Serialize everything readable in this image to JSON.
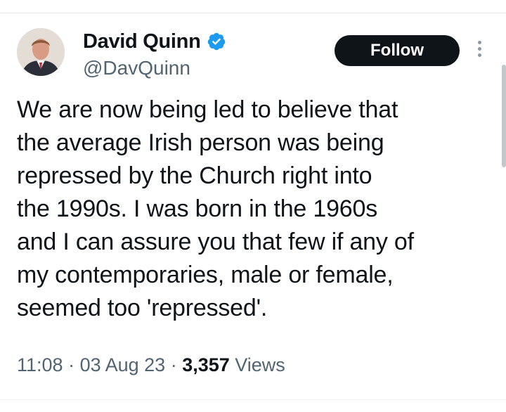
{
  "author": {
    "name": "David Quinn",
    "handle": "@DavQuinn",
    "verified_color": "#1d9bf0"
  },
  "actions": {
    "follow_label": "Follow",
    "more_icon": "more-vertical-icon"
  },
  "tweet": {
    "lines": [
      "We are now being led to believe that",
      "the average Irish person was being",
      "repressed by the Church right into",
      "the 1990s. I was born in the 1960s",
      "and I can assure you that few if any of",
      "my contemporaries, male or female,",
      "seemed too 'repressed'."
    ]
  },
  "meta": {
    "time": "11:08",
    "separator": " · ",
    "date": "03 Aug 23",
    "views_count": "3,357",
    "views_label": " Views"
  }
}
